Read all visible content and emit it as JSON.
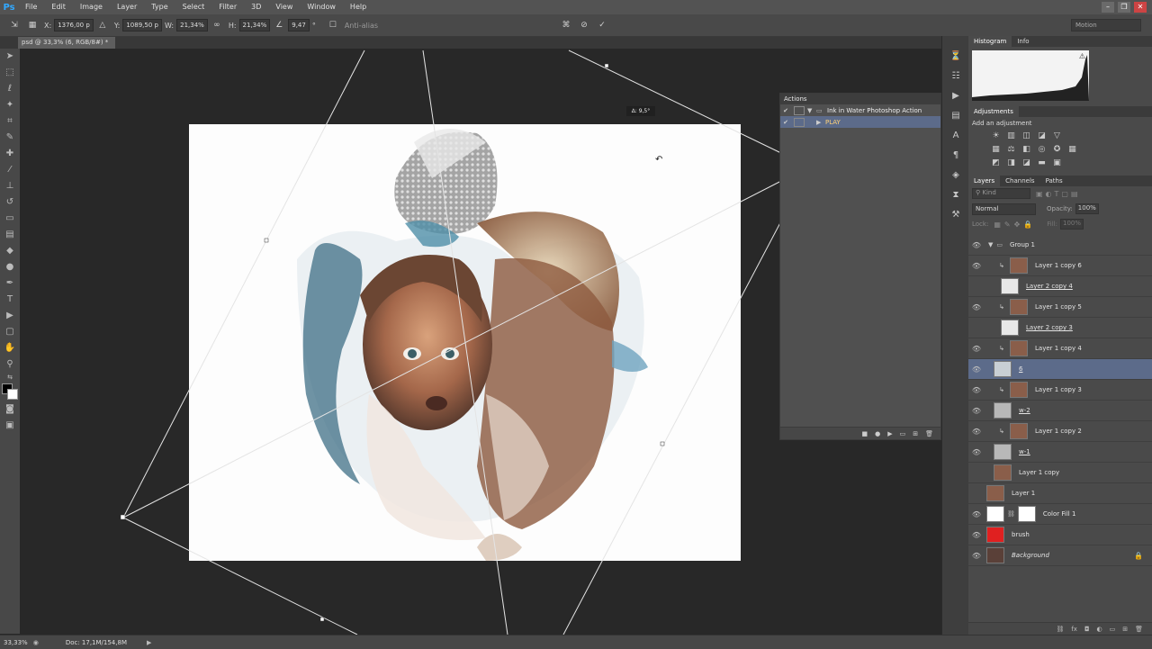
{
  "app": {
    "logo": "Ps"
  },
  "menu": [
    "File",
    "Edit",
    "Image",
    "Layer",
    "Type",
    "Select",
    "Filter",
    "3D",
    "View",
    "Window",
    "Help"
  ],
  "window_controls": [
    "–",
    "❐",
    "✕"
  ],
  "options": {
    "x_label": "X:",
    "x_value": "1376,00 p",
    "y_label": "Y:",
    "y_value": "1089,50 p",
    "w_label": "W:",
    "w_value": "21,34%",
    "h_label": "H:",
    "h_value": "21,34%",
    "angle_value": "9,47",
    "antialias_label": "Anti-alias",
    "workspace": "Motion"
  },
  "document": {
    "tab_title": "psd @ 33,3% (6, RGB/8#) *"
  },
  "canvas": {
    "transform_readout": "∆: 9,5°"
  },
  "actions_panel": {
    "title": "Actions",
    "rows": [
      {
        "label": "Ink in Water Photoshop Action",
        "selected": false
      },
      {
        "label": "PLAY",
        "selected": true
      }
    ]
  },
  "histogram_panel": {
    "tabs": [
      "Histogram",
      "Info"
    ]
  },
  "adjustments_panel": {
    "title": "Adjustments",
    "subtitle": "Add an adjustment"
  },
  "layers_panel": {
    "tabs": [
      "Layers",
      "Channels",
      "Paths"
    ],
    "kind_label": "Kind",
    "blend_mode": "Normal",
    "opacity_label": "Opacity:",
    "opacity_value": "100%",
    "lock_label": "Lock:",
    "fill_label": "Fill:",
    "fill_value": "100%",
    "layers": [
      {
        "name": "Group 1",
        "visible": true,
        "type": "group"
      },
      {
        "name": "Layer 1 copy 6",
        "visible": true,
        "clip": true
      },
      {
        "name": "Layer 2 copy 4",
        "visible": false,
        "underline": true,
        "transparent": true
      },
      {
        "name": "Layer 1 copy 5",
        "visible": true,
        "clip": true
      },
      {
        "name": "Layer 2 copy 3",
        "visible": false,
        "underline": true,
        "transparent": true
      },
      {
        "name": "Layer 1 copy 4",
        "visible": true,
        "clip": true
      },
      {
        "name": "6",
        "visible": true,
        "underline": true,
        "selected": true
      },
      {
        "name": "Layer 1 copy 3",
        "visible": true,
        "clip": true
      },
      {
        "name": "w-2",
        "visible": true,
        "underline": true
      },
      {
        "name": "Layer 1 copy 2",
        "visible": true,
        "clip": true
      },
      {
        "name": "w-1",
        "visible": true,
        "underline": true
      },
      {
        "name": "Layer 1 copy",
        "visible": false
      },
      {
        "name": "Layer 1",
        "visible": false
      },
      {
        "name": "Color Fill 1",
        "visible": true
      },
      {
        "name": "brush",
        "visible": true
      },
      {
        "name": "Background",
        "visible": true,
        "italic": true,
        "locked": true
      }
    ]
  },
  "status": {
    "zoom": "33,33%",
    "doc": "Doc: 17,1M/154,8M"
  }
}
